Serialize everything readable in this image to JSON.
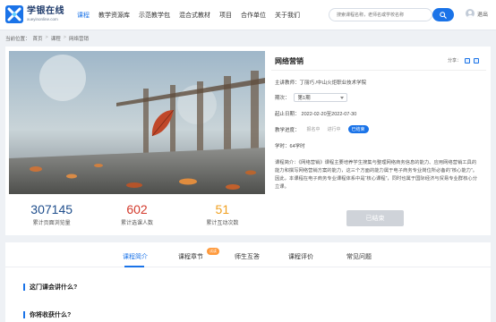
{
  "brand": {
    "name": "学银在线",
    "domain": "xueyinonline.com",
    "color": "#1a73e8"
  },
  "nav": [
    {
      "label": "课程",
      "active": true
    },
    {
      "label": "教学资源库",
      "active": false
    },
    {
      "label": "示范教学包",
      "active": false
    },
    {
      "label": "混合式教材",
      "active": false
    },
    {
      "label": "项目",
      "active": false
    },
    {
      "label": "合作单位",
      "active": false
    },
    {
      "label": "关于我们",
      "active": false
    }
  ],
  "search": {
    "placeholder": "搜索课程名称，老师名或学校名称"
  },
  "user": {
    "name": "退出"
  },
  "breadcrumb": {
    "prefix": "当前位置：",
    "items": [
      "首页",
      "课程",
      "网络营销"
    ],
    "separator": ">"
  },
  "course": {
    "title": "网络营销",
    "share_label": "分享：",
    "teacher_label": "主讲教师：",
    "teacher": "丁丽巧 /中山火炬职业技术学院",
    "term_label": "期次：",
    "term": "第1期",
    "date_label": "起止日期：",
    "date": "2022-02-20至2022-07-30",
    "progress_label": "教学进度：",
    "progress_states": [
      "报名中",
      "进行中",
      "已结束"
    ],
    "progress_current": "已结束",
    "hours_label": "学时：",
    "hours": "64学时",
    "intro_label": "课程简介：",
    "intro": "《网络营销》课程主要培养学生搜集与整理网络商务信息的能力、应用网络营销工具的能力和撰写网络营销方案的能力，这三个方面的能力属于电子商务专业岗位所必备的“核心能力”。因此，本课程在电子商务专业课程体系中是“核心课程”，同时也属于国际经济与贸易专业群核心分立课。",
    "status_button": "已结束"
  },
  "stats": [
    {
      "value": "307145",
      "label": "累计页面浏览量",
      "color": "#1f4e8c"
    },
    {
      "value": "602",
      "label": "累计选课人数",
      "color": "#d33a2c"
    },
    {
      "value": "51",
      "label": "累计互动次数",
      "color": "#f0a020"
    }
  ],
  "tabs": [
    {
      "label": "课程简介",
      "active": true
    },
    {
      "label": "课程章节",
      "active": false,
      "badge": "试读"
    },
    {
      "label": "师生互答",
      "active": false
    },
    {
      "label": "课程评价",
      "active": false
    },
    {
      "label": "常见问题",
      "active": false
    }
  ],
  "sections": [
    {
      "title": "这门课会讲什么?"
    },
    {
      "title": "你将收获什么?"
    }
  ]
}
